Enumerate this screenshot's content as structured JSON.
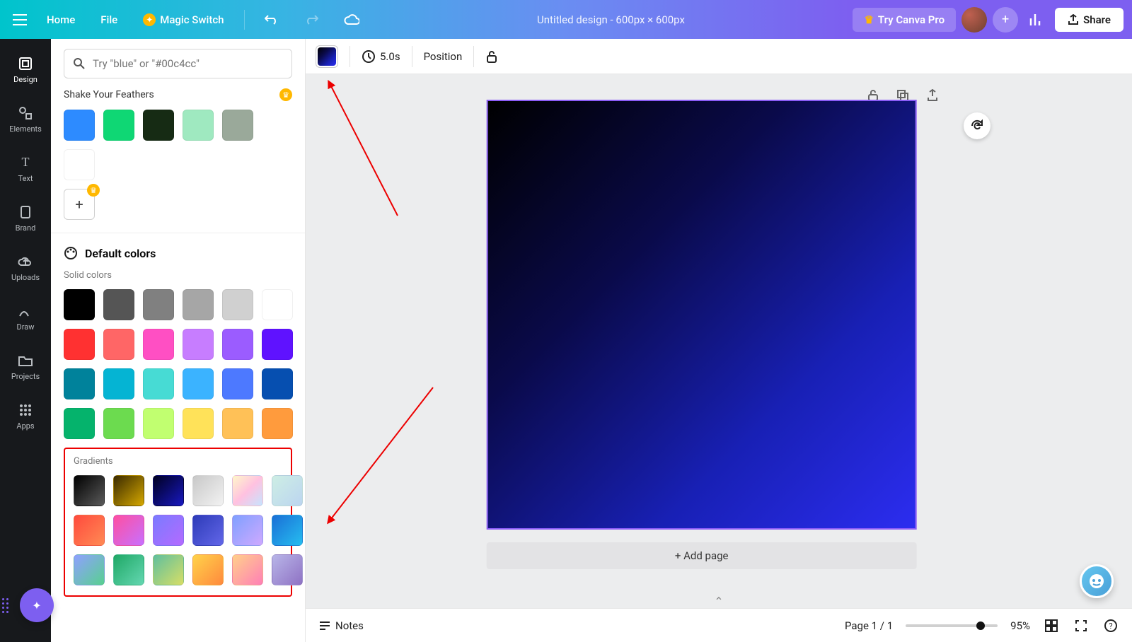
{
  "topbar": {
    "home": "Home",
    "file": "File",
    "magic": "Magic Switch",
    "title": "Untitled design - 600px × 600px",
    "try_pro": "Try Canva Pro",
    "share": "Share"
  },
  "rail": [
    {
      "label": "Design"
    },
    {
      "label": "Elements"
    },
    {
      "label": "Text"
    },
    {
      "label": "Brand"
    },
    {
      "label": "Uploads"
    },
    {
      "label": "Draw"
    },
    {
      "label": "Projects"
    },
    {
      "label": "Apps"
    }
  ],
  "panel": {
    "search_placeholder": "Try \"blue\" or \"#00c4cc\"",
    "palette_name": "Shake Your Feathers",
    "palette_colors": [
      "#2d8bff",
      "#0fd774",
      "#162b14",
      "#9fe9c0",
      "#9aa99a",
      "#ffffff"
    ],
    "default_header": "Default colors",
    "solid_label": "Solid colors",
    "solid_colors": [
      "#000000",
      "#555555",
      "#808080",
      "#a6a6a6",
      "#d0d0d0",
      "#ffffff",
      "#ff3131",
      "#ff6666",
      "#ff4fc3",
      "#c77dff",
      "#9b5cff",
      "#5f12ff",
      "#00829b",
      "#05b4d3",
      "#47dbd4",
      "#3bb3ff",
      "#4d79ff",
      "#064fb0",
      "#05b36c",
      "#6cdb4f",
      "#c1ff70",
      "#ffe259",
      "#ffc157",
      "#ff9b3d"
    ],
    "grad_label": "Gradients",
    "gradients": [
      "linear-gradient(135deg,#000,#5a5a5a)",
      "linear-gradient(135deg,#3a2a00,#d6a800)",
      "linear-gradient(135deg,#000020,#1818c0)",
      "linear-gradient(135deg,#c8c8c8,#f2f2f2)",
      "linear-gradient(135deg,#fff7c9,#ffc1e0,#c6e4ff)",
      "linear-gradient(135deg,#cdeee4,#bcd5f0)",
      "linear-gradient(135deg,#ff4a3d,#ff8a54)",
      "linear-gradient(135deg,#ff4fa0,#c770ff)",
      "linear-gradient(135deg,#7a7bff,#b46aff)",
      "linear-gradient(135deg,#2d3bb8,#6266e8)",
      "linear-gradient(135deg,#7fa0ff,#cfa9ff)",
      "linear-gradient(135deg,#1a6fd6,#26bdf0)",
      "linear-gradient(135deg,#8fa0ff,#58d090)",
      "linear-gradient(135deg,#1fa866,#64d7b1)",
      "linear-gradient(135deg,#5fbf9e,#d7de66)",
      "linear-gradient(135deg,#ffd24a,#ff8a3d)",
      "linear-gradient(135deg,#ffd08a,#ff7fb6)",
      "linear-gradient(135deg,#b8b5e8,#8f72c4)"
    ]
  },
  "ctx": {
    "duration": "5.0s",
    "position": "Position"
  },
  "canvas": {
    "add_page": "+ Add page"
  },
  "bottom": {
    "notes": "Notes",
    "page_label": "Page 1 / 1",
    "zoom": "95%"
  }
}
